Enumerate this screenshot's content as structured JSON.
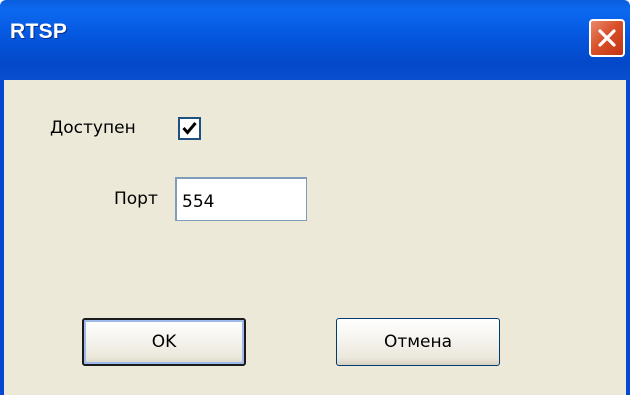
{
  "dialog": {
    "title": "RTSP",
    "enabled_label": "Доступен",
    "enabled_checked": true,
    "port_label": "Порт",
    "port_value": "554",
    "ok_label": "OK",
    "cancel_label": "Отмена"
  },
  "icons": {
    "close": "close-icon",
    "check": "checkmark-icon"
  },
  "colors": {
    "titlebar": "#0557df",
    "client_background": "#ece9d8",
    "close_button": "#d9512b",
    "input_border": "#7f9db9"
  }
}
